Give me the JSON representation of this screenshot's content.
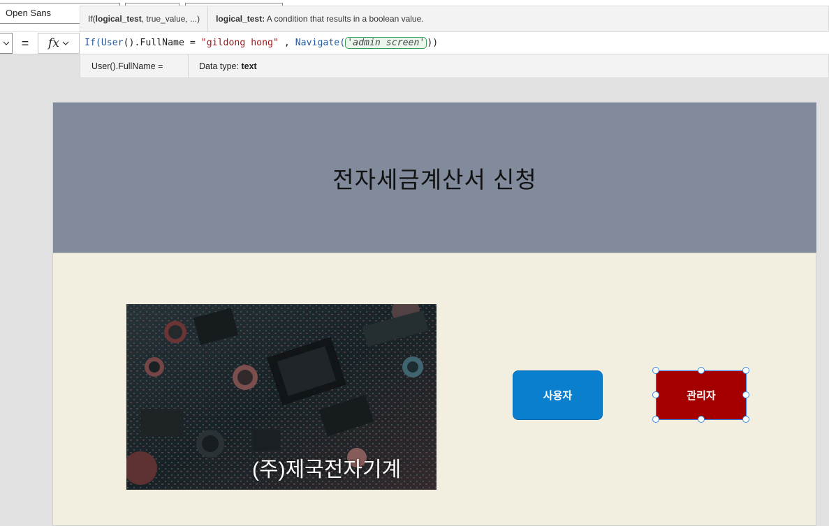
{
  "toolbar": {
    "font_name": "Open Sans"
  },
  "tooltip": {
    "fn_name": "If(",
    "fn_param_active": "logical_test",
    "fn_rest": ", true_value, ...)",
    "param_label": "logical_test:",
    "param_desc": " A condition that results in a boolean value."
  },
  "formula_bar": {
    "equals": "=",
    "fx_label": "fx",
    "tokens": {
      "t1": "If(",
      "t2": "User",
      "t3": "().FullName = ",
      "t4": "\"gildong hong\"",
      "t5": " , ",
      "t6": "Navigate(",
      "t7": "'admin screen'",
      "t8": "))"
    }
  },
  "result": {
    "expression": "User().FullName  =",
    "type_label": "Data type: ",
    "type_value": "text"
  },
  "canvas": {
    "header_title": "전자세금계산서 신청",
    "photo_caption": "(주)제국전자기계",
    "user_button_label": "사용자",
    "admin_button_label": "관리자",
    "colors": {
      "header_bg": "#818b9c",
      "body_bg": "#f2efe0",
      "user_button": "#0a7fce",
      "admin_button": "#a40000"
    }
  }
}
